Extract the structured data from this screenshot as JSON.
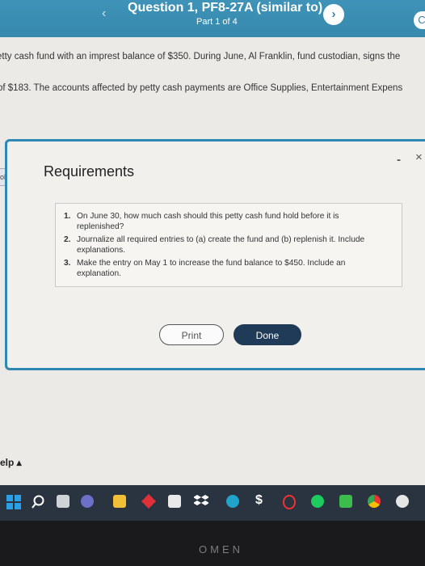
{
  "header": {
    "title": "Question 1, PF8-27A (similar to)",
    "subtitle": "Part 1 of 4",
    "prev_icon": "‹",
    "next_icon": "›"
  },
  "question": {
    "line1": "etty cash fund with an imprest balance of $350. During June, Al Franklin, fund custodian, signs the",
    "line2": " of $183. The accounts affected by petty cash payments are Office Supplies, Entertainment Expens"
  },
  "side_tab_label": "old",
  "dialog": {
    "title": "Requirements",
    "minimize_glyph": "-",
    "close_glyph": "×",
    "requirements": [
      {
        "num": "1.",
        "text": "On June 30, how much cash should this petty cash fund hold before it is replenished?"
      },
      {
        "num": "2.",
        "text": "Journalize all required entries to (a) create the fund and (b) replenish it. Include explanations."
      },
      {
        "num": "3.",
        "text": "Make the entry on May 1 to increase the fund balance to $450. Include an explanation."
      }
    ],
    "print_label": "Print",
    "done_label": "Done"
  },
  "help_label": "elp ▴",
  "taskbar": {
    "icons": [
      "windows-start-icon",
      "search-icon",
      "taskview-icon",
      "teams-icon",
      "file-explorer-icon",
      "red-diamond-app-icon",
      "store-icon",
      "dropbox-icon",
      "edge-icon",
      "dollar-app-icon",
      "opera-icon",
      "spotify-icon",
      "green-app-icon",
      "chrome-icon",
      "photos-icon"
    ]
  },
  "bezel_brand": "OMEN"
}
